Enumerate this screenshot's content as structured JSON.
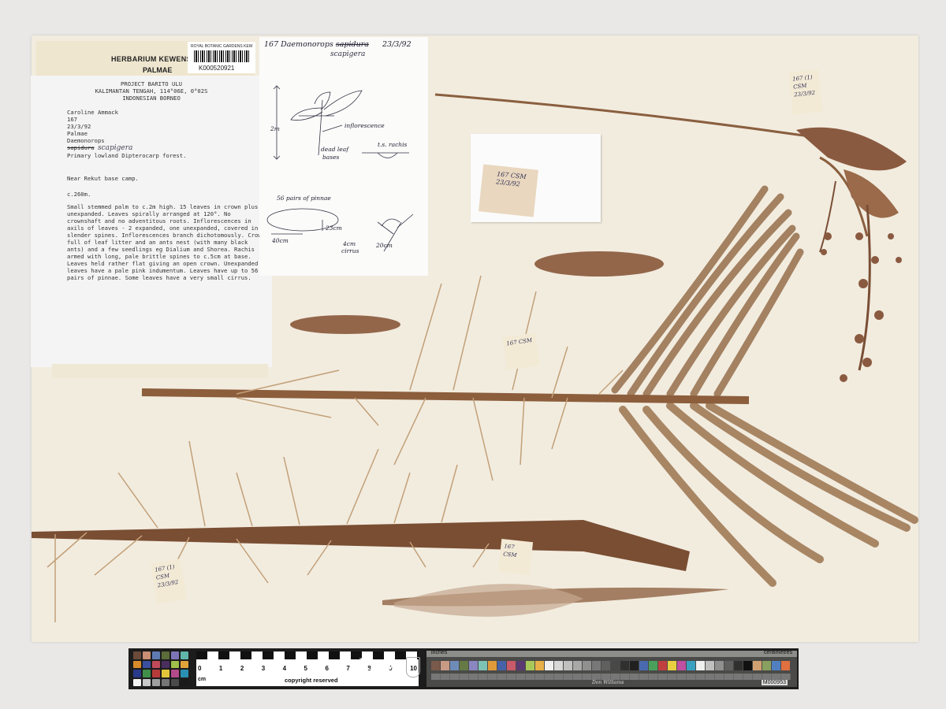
{
  "header": {
    "herbarium": "HERBARIUM KEWENSE",
    "family": "PALMAE",
    "barcode_org": "ROYAL BOTANIC GARDENS KEW",
    "barcode_number": "K000520921"
  },
  "main_label": {
    "project": "PROJECT BARITO ULU",
    "location": "KALIMANTAN TENGAH, 114°06E, 0°02S",
    "region": "INDONESIAN BORNEO",
    "collector": "Caroline Ammack",
    "number": "167",
    "date": "23/3/92",
    "family": "Palmae",
    "genus": "Daemonorops",
    "struck_epithet": "sapidura",
    "hand_epithet": "scapigera",
    "habitat": "Primary lowland Dipterocarp forest.",
    "site": "Near Rekut base camp.",
    "elevation": "c.260m.",
    "description": "Small stemmed palm to c.2m high. 15 leaves in crown plus 2 unexpanded. Leaves spirally arranged at 120°. No crownshaft and no adventitous roots. Inflorescences in axils of leaves - 2 expanded, one unexpanded, covered in slender spines. Inflorescences branch dichotomously. Crown full of leaf litter and an ants nest (with many black ants) and a few seedlings eg Dialium and Shorea. Rachis armed with long, pale brittle spines to c.5cm at base. Leaves held rather flat giving an open crown. Unexpanded leaves have a pale pink indumentum. Leaves have up to 56 pairs of pinnae. Some leaves have a very small cirrus."
  },
  "sketch": {
    "title": "167 Daemonorops",
    "struck": "sapidura",
    "date": "23/3/92",
    "sci": "scapigera",
    "height": "2m",
    "inflorescence": "inflorescence",
    "dead_leaf": "dead leaf",
    "bases": "bases",
    "rachis": "t.s. rachis",
    "pinnae": "56 pairs of pinnae",
    "width": "23cm",
    "length": "40cm",
    "cirrus_len": "4cm",
    "cirrus": "cirrus",
    "span": "20cm"
  },
  "packet": {
    "tag": "167 CSM 23/3/92"
  },
  "tags": {
    "top_right": "167 (1) CSM 23/3/92",
    "middle": "167 CSM",
    "bottom_left": "167 (1) CSM 23/3/92",
    "bottom_mid": "167 CSM"
  },
  "scale_bar": {
    "ruler_numbers": [
      "0",
      "1",
      "2",
      "3",
      "4",
      "5",
      "6",
      "7",
      "8",
      "9",
      "10"
    ],
    "unit": "cm",
    "copyright": "copyright reserved",
    "brand": "Kew",
    "brand_sub": "Royal Botanic Gardens",
    "inches": "inches",
    "centimetres": "centimetres",
    "signature": "Don Williams",
    "code": "M000953",
    "swatch_colors": [
      "#6b4a3a",
      "#c98e74",
      "#5e7ab0",
      "#5b6b3a",
      "#7d74b6",
      "#5fb6a9",
      "#d98b2b",
      "#3b4fa0",
      "#c04a5a",
      "#4a2f5e",
      "#9fc04a",
      "#e0a43a",
      "#2a3a8a",
      "#3f8f4a",
      "#b83a3a",
      "#e3c53a",
      "#b34a8a",
      "#2a8fb0",
      "#f4f4f4",
      "#c9c9c9",
      "#a0a0a0",
      "#767676",
      "#4a4a4a",
      "#1a1a1a"
    ]
  }
}
